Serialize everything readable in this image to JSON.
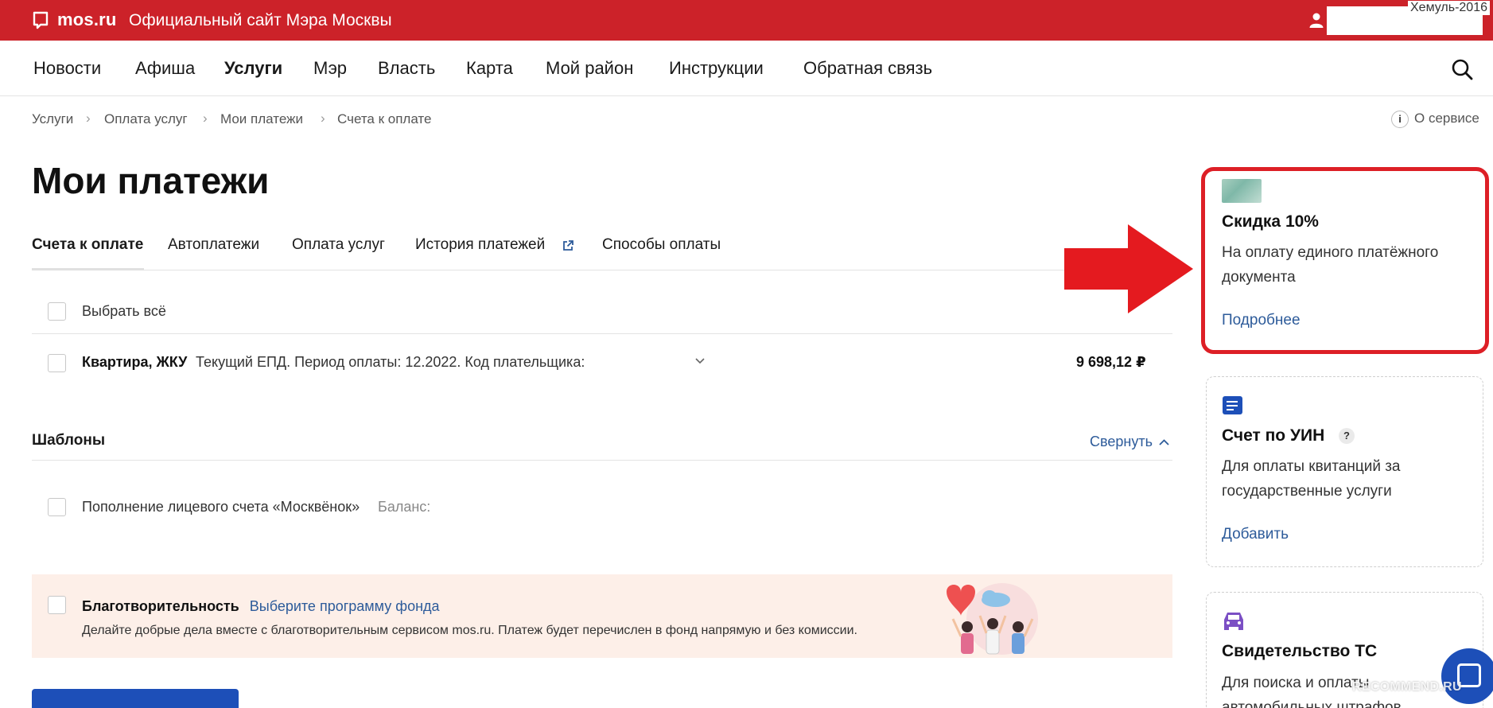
{
  "brand": {
    "logo_text": "mos.ru",
    "site_title": "Официальный сайт Мэра Москвы",
    "color": "#cc2229"
  },
  "watermark": {
    "top": "Хемуль-2016",
    "bottom": "RECOMMEND.RU"
  },
  "nav": {
    "items": [
      "Новости",
      "Афиша",
      "Услуги",
      "Мэр",
      "Власть",
      "Карта",
      "Мой район",
      "Инструкции",
      "Обратная связь"
    ],
    "active": "Услуги"
  },
  "breadcrumbs": [
    "Услуги",
    "Оплата услуг",
    "Мои платежи",
    "Счета к оплате"
  ],
  "about": {
    "icon": "i",
    "label": "О сервисе"
  },
  "page_title": "Мои платежи",
  "tabs": [
    "Счета к оплате",
    "Автоплатежи",
    "Оплата услуг",
    "История платежей",
    "Способы оплаты"
  ],
  "select_all": "Выбрать всё",
  "bill": {
    "title": "Квартира, ЖКУ",
    "description": "Текущий ЕПД. Период оплаты: 12.2022. Код плательщика:",
    "amount": "9 698,12 ₽"
  },
  "templates": {
    "title": "Шаблоны",
    "collapse_label": "Свернуть",
    "item_title": "Пополнение лицевого счета «Москвёнок»",
    "item_balance": "Баланс:"
  },
  "charity": {
    "title": "Благотворительность",
    "link": "Выберите программу фонда",
    "description": "Делайте добрые дела вместе с благотворительным сервисом mos.ru. Платеж будет перечислен в фонд напрямую и без комиссии."
  },
  "cards": {
    "discount": {
      "title": "Скидка 10%",
      "desc_line1": "На оплату единого платёжного",
      "desc_line2": "документа",
      "link": "Подробнее"
    },
    "uin": {
      "title": "Счет по УИН",
      "help": "?",
      "desc_line1": "Для оплаты квитанций за",
      "desc_line2": "государственные услуги",
      "link": "Добавить"
    },
    "vehicle": {
      "title": "Свидетельство ТС",
      "desc_line1": "Для поиска и оплаты",
      "desc_line2": "автомобильных штрафов"
    }
  },
  "colors": {
    "accent_red": "#cc2229",
    "link_blue": "#2d5b9a",
    "primary_blue": "#1d4fb8",
    "charity_bg": "#fdefe8"
  }
}
